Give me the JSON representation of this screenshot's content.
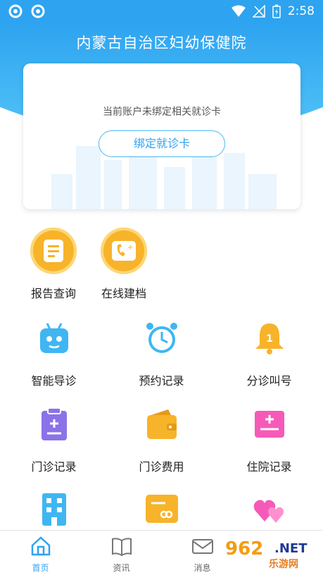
{
  "status_bar": {
    "time": "2:58"
  },
  "header": {
    "title": "内蒙古自治区妇幼保健院"
  },
  "card": {
    "notice": "当前账户未绑定相关就诊卡",
    "bind_button": "绑定就诊卡"
  },
  "features": [
    {
      "label": "报告查询",
      "icon": "report-icon"
    },
    {
      "label": "在线建档",
      "icon": "file-phone-icon"
    }
  ],
  "grid": [
    {
      "label": "智能导诊",
      "icon": "robot-icon",
      "color": "#3fb6f2"
    },
    {
      "label": "预约记录",
      "icon": "alarm-clock-icon",
      "color": "#3fb6f2"
    },
    {
      "label": "分诊叫号",
      "icon": "bell-icon",
      "color": "#f7b32a",
      "badge": "1"
    },
    {
      "label": "门诊记录",
      "icon": "clipboard-icon",
      "color": "#8b72e8"
    },
    {
      "label": "门诊费用",
      "icon": "wallet-icon",
      "color": "#f7b32a"
    },
    {
      "label": "住院记录",
      "icon": "hospital-card-icon",
      "color": "#f65ab8"
    },
    {
      "label": "",
      "icon": "building-icon",
      "color": "#3fb6f2"
    },
    {
      "label": "",
      "icon": "card-icon",
      "color": "#f7b32a"
    },
    {
      "label": "",
      "icon": "hearts-icon",
      "color": "#f65ab8"
    }
  ],
  "tabs": [
    {
      "label": "首页",
      "icon": "home-icon",
      "active": true
    },
    {
      "label": "资讯",
      "icon": "book-icon"
    },
    {
      "label": "消息",
      "icon": "mail-icon"
    }
  ],
  "watermark": {
    "number": "962",
    "dot": ".NET",
    "site": "乐游网"
  },
  "colors": {
    "primary": "#2ea3f0",
    "accent": "#f7b32a"
  }
}
